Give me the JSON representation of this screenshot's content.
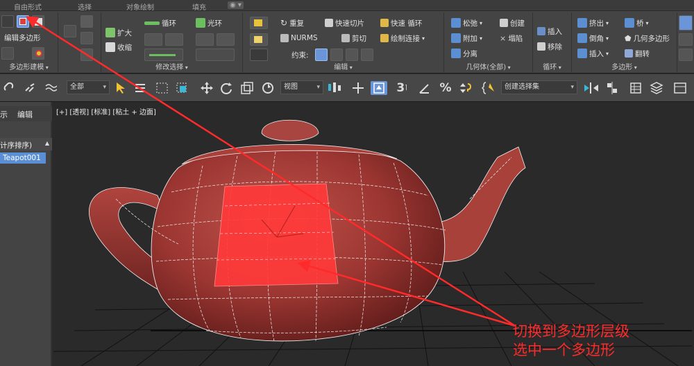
{
  "tabs": [
    "自由形式",
    "选择",
    "对象绘制",
    "填充",
    "◉ ▾"
  ],
  "ribbon": {
    "polygon_modeling": {
      "mode_label": "编辑多边形",
      "title": "多边形建模"
    },
    "modify_selection": {
      "grow": "扩大",
      "shrink": "收缩",
      "loop": "循环",
      "ring": "光环",
      "title": "修改选择"
    },
    "edit": {
      "repeat": "重复",
      "quickslice": "快速切片",
      "quickloop": "快速 循环",
      "nurms": "NURMS",
      "cut": "剪切",
      "paintconnect": "绘制连接",
      "constraints": "约束:",
      "title": "编辑"
    },
    "geometry": {
      "relax": "松弛",
      "create": "创建",
      "attach": "附加",
      "collapse": "塌陷",
      "detach": "分离",
      "title": "几何体(全部)"
    },
    "loops": {
      "insert": "插入",
      "remove": "移除",
      "title": "循环"
    },
    "polygons": {
      "extrude": "挤出",
      "bridge": "桥",
      "bevel": "倒角",
      "geopoly": "几何多边形",
      "inset": "插入",
      "flip": "翻转",
      "title": "多边形"
    }
  },
  "toolbar": {
    "filter": "全部",
    "refcoord": "视图",
    "spinner_value": "3",
    "selset": "创建选择集"
  },
  "leftpanel": {
    "tab_display": "示",
    "tab_edit": "编辑",
    "sort_label": "计序排序)",
    "item": "Teapot001"
  },
  "viewport": {
    "label": "[+] [透视] [标准] [粘土 + 边面]"
  },
  "annotation": {
    "line1": "切换到多边形层级",
    "line2": "选中一个多边形"
  },
  "colors": {
    "accent": "#5a8fd6",
    "teapot": "#9c3632",
    "arrow": "#ff2a2a",
    "selected_face": "#ff3a3a"
  }
}
